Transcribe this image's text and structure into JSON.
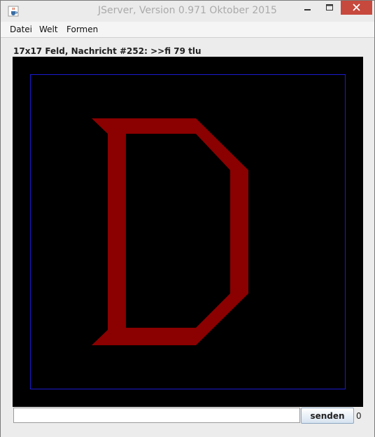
{
  "window": {
    "title": "JServer, Version 0.971 Oktober 2015"
  },
  "menubar": {
    "items": [
      "Datei",
      "Welt",
      "Formen"
    ]
  },
  "status": {
    "text": "17x17 Feld, Nachricht #252: >>fi 79 tlu"
  },
  "board": {
    "size": "17x17",
    "background": "#000000",
    "frame_color": "#1a1ad0",
    "shape_color": "#8b0000",
    "shape": "letter D"
  },
  "input": {
    "value": ""
  },
  "send_button": {
    "label": "senden"
  },
  "counter": {
    "value": "0"
  },
  "colors": {
    "close_button": "#c7483d",
    "window_bg": "#ececec"
  }
}
